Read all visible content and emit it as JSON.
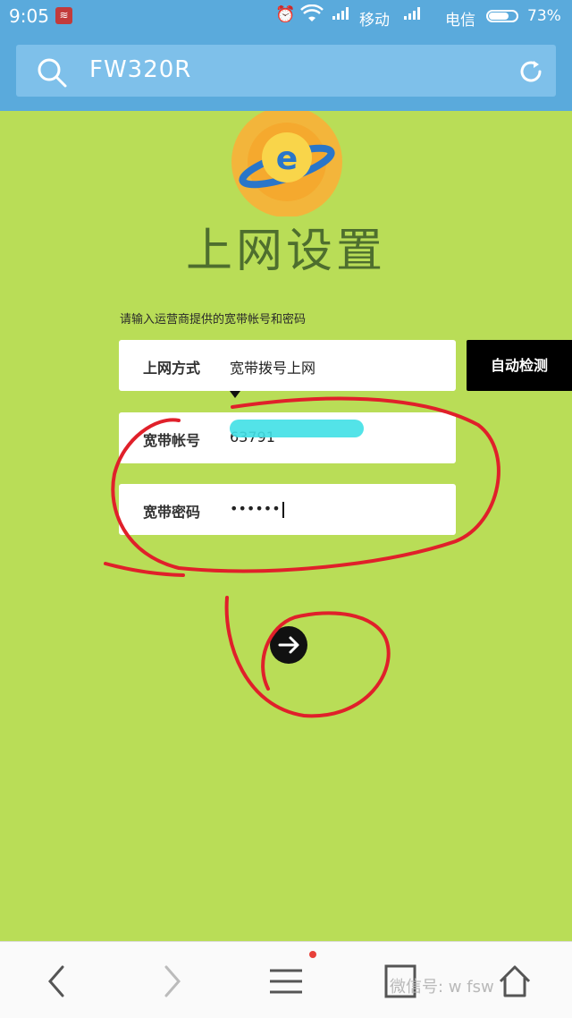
{
  "status_bar": {
    "time": "9:05",
    "carrier1": "移动",
    "carrier2": "电信",
    "battery": "73%",
    "battery_level": 0.73
  },
  "header": {
    "search_text": "FW320R"
  },
  "page": {
    "title": "上网设置",
    "instruction": "请输入运营商提供的宽带帐号和密码"
  },
  "form": {
    "connection_type_label": "上网方式",
    "connection_type_value": "宽带拨号上网",
    "auto_detect_label": "自动检测",
    "account_label": "宽带帐号",
    "account_value": "63791",
    "password_label": "宽带密码",
    "password_value": "••••••"
  },
  "bottom_nav": {
    "watermark": "微信号: w     fsw"
  },
  "colors": {
    "background": "#b9dd57",
    "header": "#5aaadc",
    "annotation": "#e0202a"
  }
}
